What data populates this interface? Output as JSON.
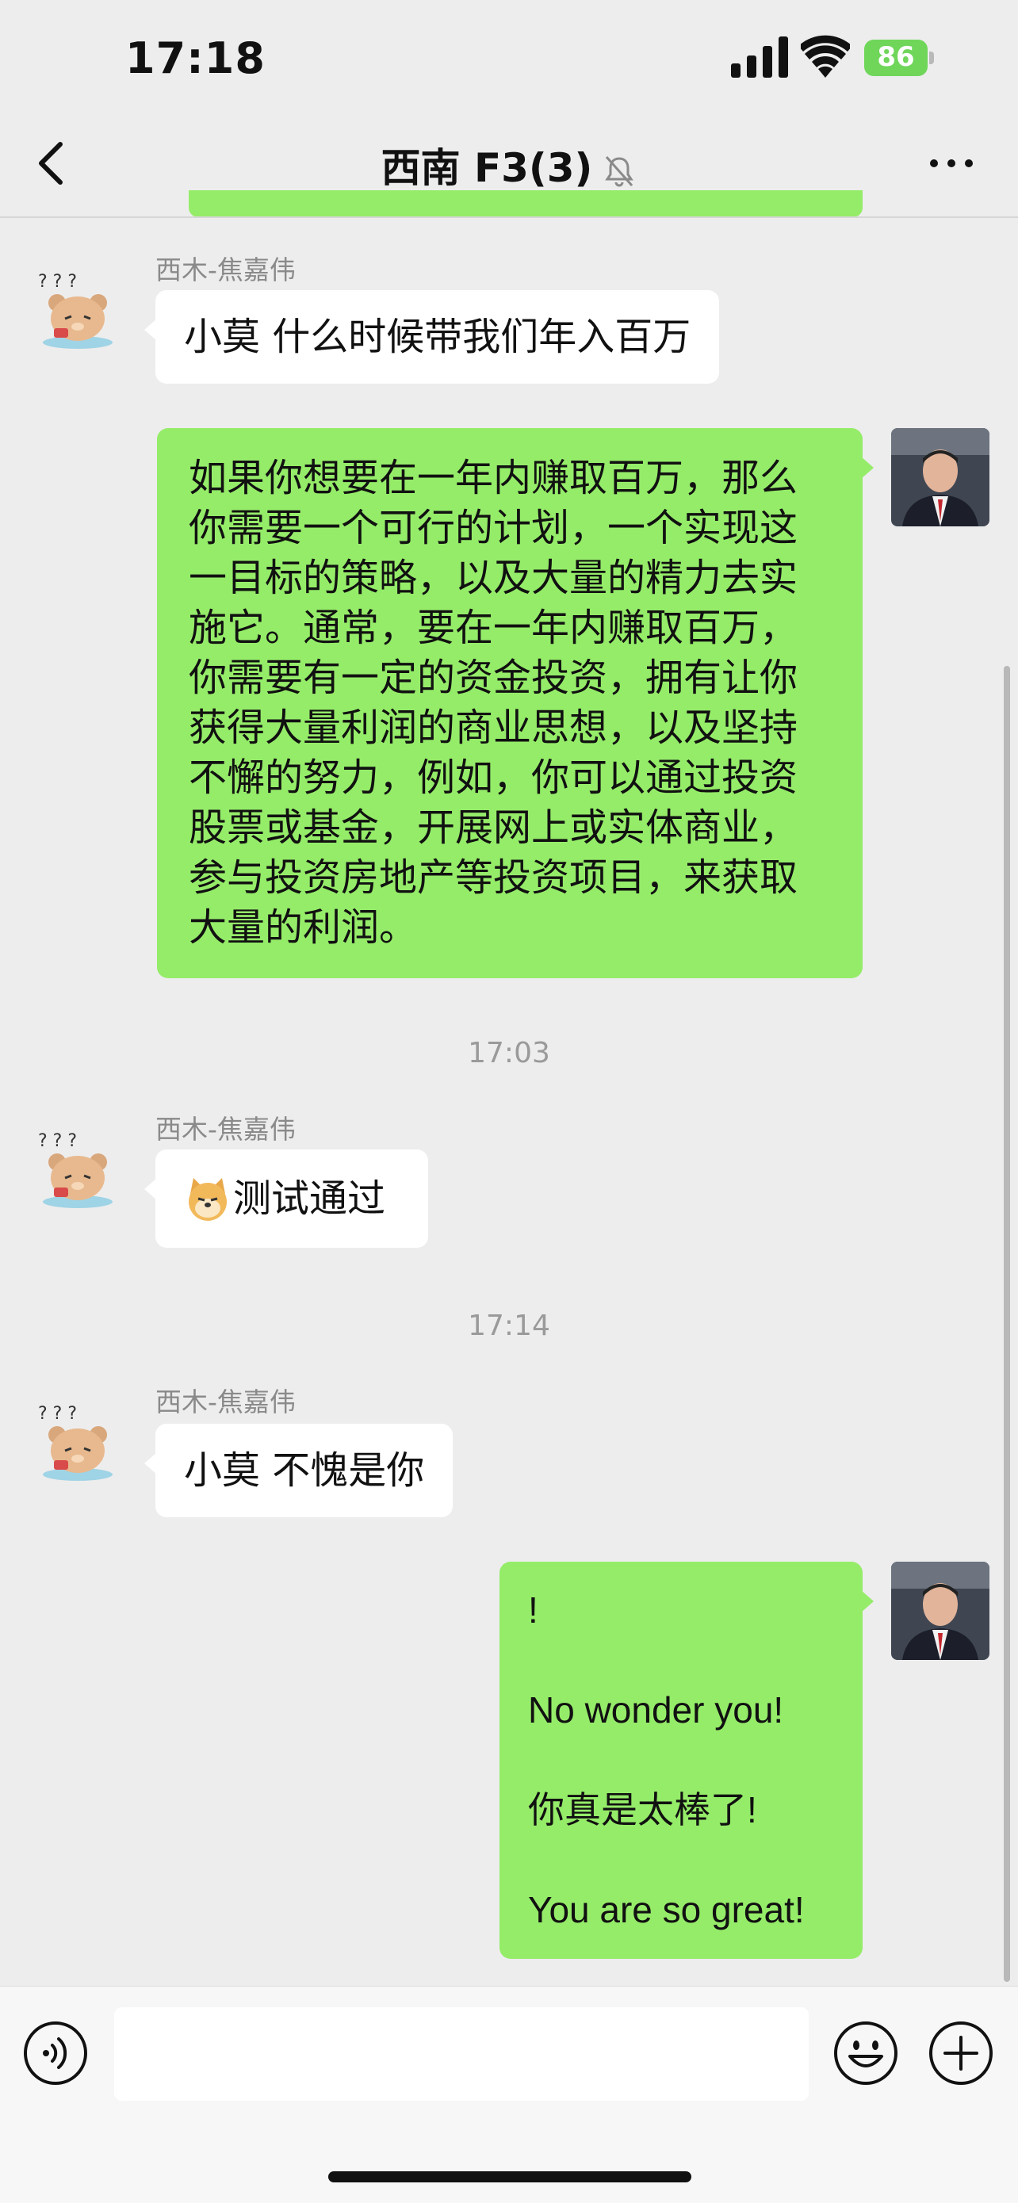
{
  "status_bar": {
    "time": "17:18",
    "battery": "86"
  },
  "nav": {
    "title": "西南 F3(3)"
  },
  "messages": [
    {
      "sender": "西木-焦嘉伟",
      "text": "小莫 什么时候带我们年入百万"
    },
    {
      "text": "如果你想要在一年内赚取百万，那么你需要一个可行的计划，一个实现这一目标的策略，以及大量的精力去实施它。通常，要在一年内赚取百万，你需要有一定的资金投资，拥有让你获得大量利润的商业思想，以及坚持不懈的努力，例如，你可以通过投资股票或基金，开展网上或实体商业，参与投资房地产等投资项目，来获取大量的利润。"
    },
    {
      "sender": "西木-焦嘉伟",
      "text": "测试通过"
    },
    {
      "sender": "西木-焦嘉伟",
      "text": "小莫 不愧是你"
    },
    {
      "text": "!\n\nNo wonder you!\n\n你真是太棒了!\n\nYou are so great!"
    }
  ],
  "timestamps": [
    "17:03",
    "17:14"
  ],
  "input": {
    "placeholder": ""
  },
  "colors": {
    "outgoing_bubble": "#95ec69",
    "incoming_bubble": "#ffffff",
    "background": "#ededed"
  }
}
